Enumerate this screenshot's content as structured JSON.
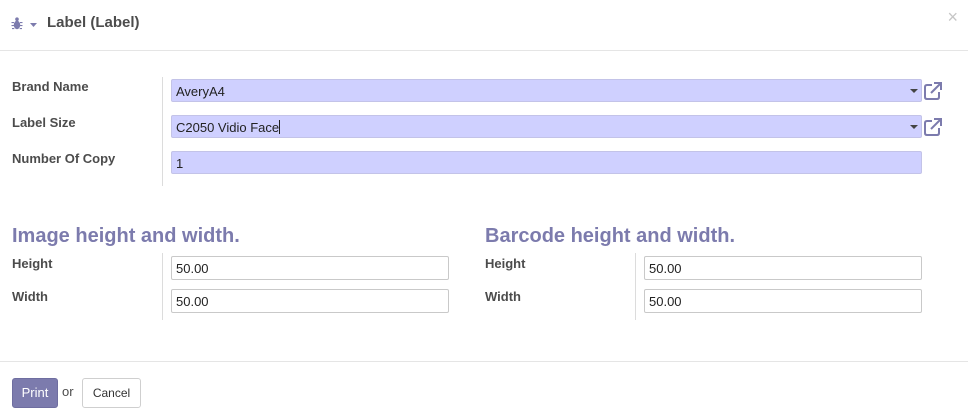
{
  "dialog": {
    "title": "Label (Label)",
    "close_symbol": "×"
  },
  "fields": {
    "brand_name": {
      "label": "Brand Name",
      "value": "AveryA4"
    },
    "label_size": {
      "label": "Label Size",
      "value": "C2050 Vidio Face"
    },
    "number_of_copy": {
      "label": "Number Of Copy",
      "value": "1"
    }
  },
  "image_section": {
    "heading": "Image height and width.",
    "height_label": "Height",
    "height_value": "50.00",
    "width_label": "Width",
    "width_value": "50.00"
  },
  "barcode_section": {
    "heading": "Barcode height and width.",
    "height_label": "Height",
    "height_value": "50.00",
    "width_label": "Width",
    "width_value": "50.00"
  },
  "footer": {
    "print_label": "Print",
    "or_text": "or",
    "cancel_label": "Cancel"
  },
  "colors": {
    "accent": "#7c7bad",
    "required_field_bg": "#cfd0ff"
  },
  "icons": {
    "debug": "bug-icon",
    "debug_menu": "caret-down-icon",
    "external": "external-link-icon"
  }
}
